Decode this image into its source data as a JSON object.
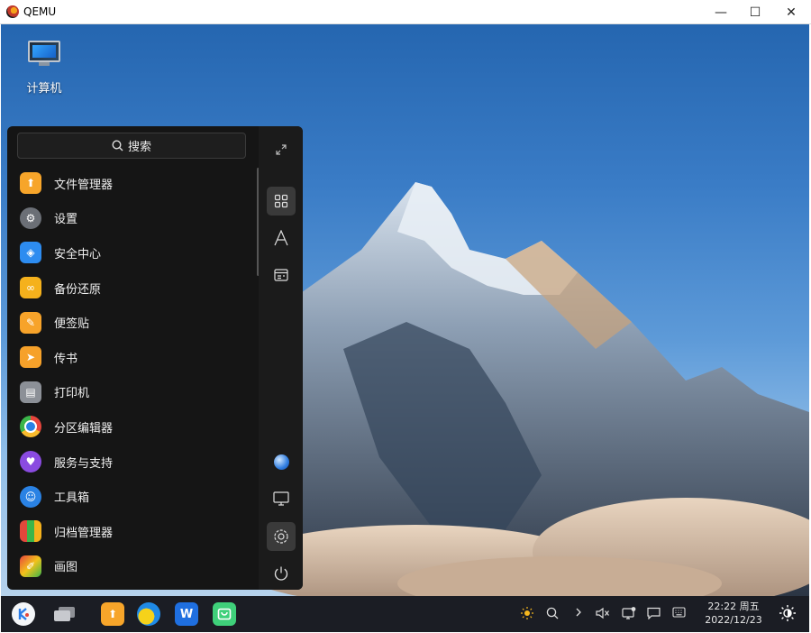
{
  "window": {
    "title": "QEMU",
    "minimize": "—",
    "maximize": "☐",
    "close": "✕"
  },
  "desktop": {
    "icon_label": "计算机"
  },
  "menu": {
    "search_placeholder": "搜索",
    "apps": [
      {
        "label": "文件管理器",
        "icon": "file-manager-icon",
        "color": "#f7a52a"
      },
      {
        "label": "设置",
        "icon": "settings-icon",
        "color": "#6b6f76"
      },
      {
        "label": "安全中心",
        "icon": "security-center-icon",
        "color": "#2d8cf0"
      },
      {
        "label": "备份还原",
        "icon": "backup-icon",
        "color": "#f5b11c"
      },
      {
        "label": "便签贴",
        "icon": "notes-icon",
        "color": "#f7a32a"
      },
      {
        "label": "传书",
        "icon": "transfer-icon",
        "color": "#f6a12a"
      },
      {
        "label": "打印机",
        "icon": "printer-icon",
        "color": "#8c9097"
      },
      {
        "label": "分区编辑器",
        "icon": "partition-editor-icon",
        "color": "#3bb54a"
      },
      {
        "label": "服务与支持",
        "icon": "service-support-icon",
        "color": "#8a4be0"
      },
      {
        "label": "工具箱",
        "icon": "toolbox-icon",
        "color": "#2a82e4"
      },
      {
        "label": "归档管理器",
        "icon": "archive-manager-icon",
        "color": "#e2483b"
      },
      {
        "label": "画图",
        "icon": "paint-icon",
        "color": "#f2c21b"
      }
    ]
  },
  "clock": {
    "time_day": "22:22 周五",
    "date": "2022/12/23"
  },
  "colors": {
    "menu_bg": "#151515",
    "rail_bg": "#1b1b1b",
    "taskbar_bg": "#1b1d24"
  }
}
